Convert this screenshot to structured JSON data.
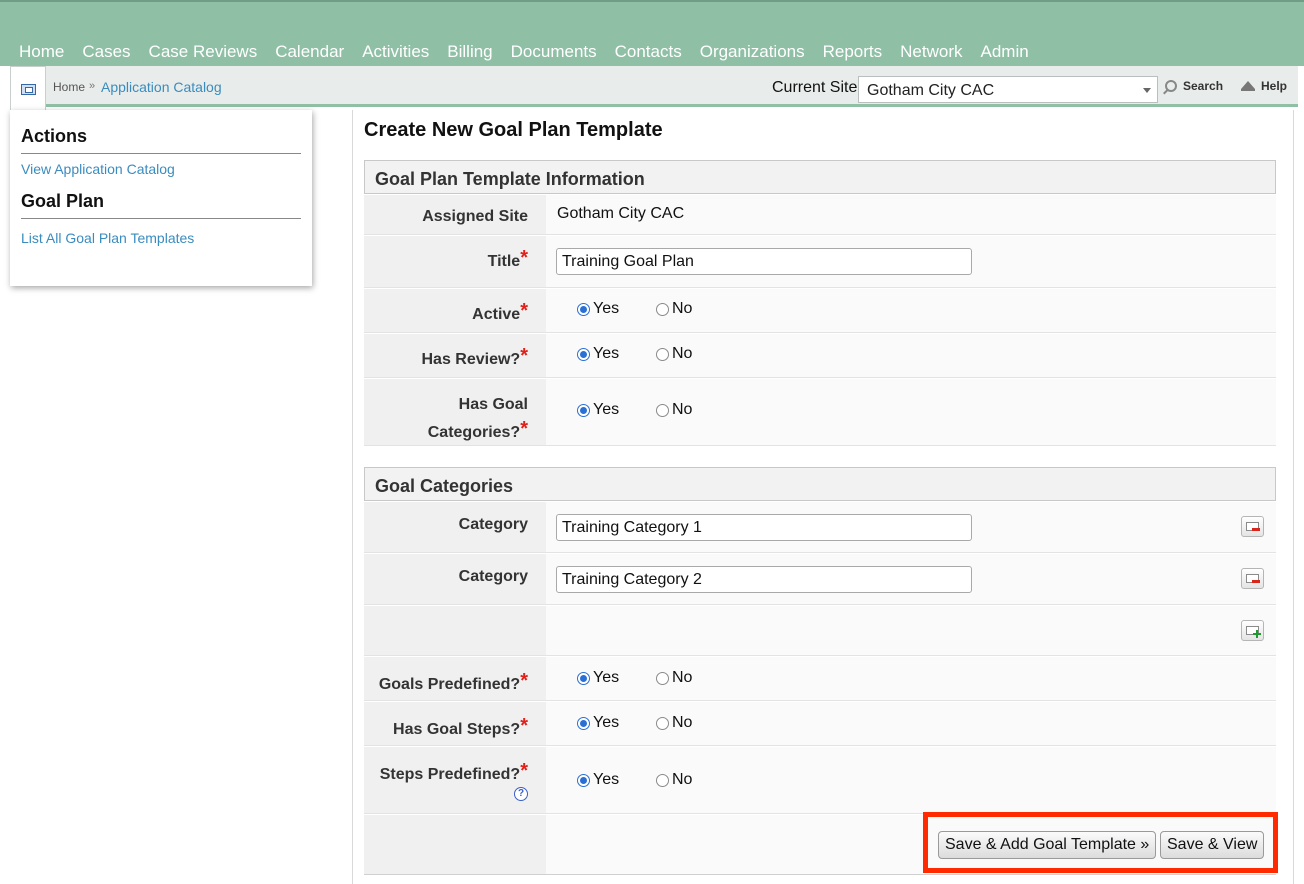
{
  "nav": {
    "items": [
      "Home",
      "Cases",
      "Case Reviews",
      "Calendar",
      "Activities",
      "Billing",
      "Documents",
      "Contacts",
      "Organizations",
      "Reports",
      "Network",
      "Admin"
    ]
  },
  "breadcrumb": {
    "home": "Home",
    "separator": "»",
    "current": "Application Catalog"
  },
  "site": {
    "label": "Current Site",
    "selected": "Gotham City CAC"
  },
  "toolbar": {
    "search": "Search",
    "help": "Help"
  },
  "sidebar": {
    "sections": [
      {
        "heading": "Actions",
        "links": [
          "View Application Catalog"
        ]
      },
      {
        "heading": "Goal Plan",
        "links": [
          "List All Goal Plan Templates"
        ]
      }
    ]
  },
  "page": {
    "title": "Create New Goal Plan Template"
  },
  "info_section": {
    "heading": "Goal Plan Template Information",
    "assigned_site_label": "Assigned Site",
    "assigned_site_value": "Gotham City CAC",
    "title_label": "Title",
    "title_value": "Training Goal Plan",
    "active_label": "Active",
    "active_value": "Yes",
    "has_review_label": "Has Review?",
    "has_review_value": "Yes",
    "has_goal_categories_label_line1": "Has Goal",
    "has_goal_categories_label_line2": "Categories?",
    "has_goal_categories_value": "Yes"
  },
  "categories_section": {
    "heading": "Goal Categories",
    "category_label": "Category",
    "categories": [
      "Training Category 1",
      "Training Category 2"
    ],
    "goals_predefined_label": "Goals Predefined?",
    "goals_predefined_value": "Yes",
    "has_goal_steps_label": "Has Goal Steps?",
    "has_goal_steps_value": "Yes",
    "steps_predefined_label": "Steps Predefined?",
    "steps_predefined_value": "Yes"
  },
  "options": {
    "yes": "Yes",
    "no": "No"
  },
  "required_marker": "*",
  "help_marker": "?",
  "buttons": {
    "save_add": "Save & Add Goal Template »",
    "save_view": "Save & View"
  },
  "colors": {
    "nav_bg": "#8fbfa5",
    "link": "#3a8cbf",
    "required": "#e0201a",
    "radio_selected": "#2a6fd6",
    "highlight": "#ff2a00"
  }
}
